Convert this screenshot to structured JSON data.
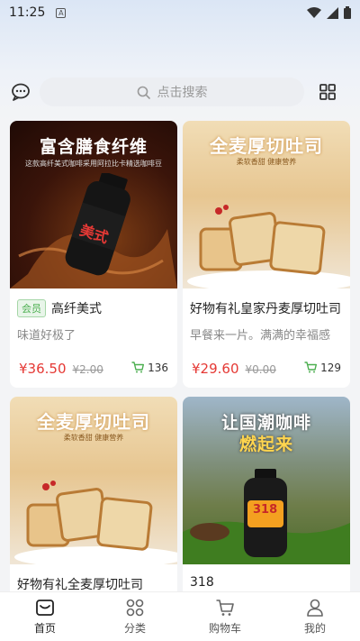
{
  "status_bar": {
    "time": "11:25",
    "notify_badge": "A"
  },
  "search": {
    "placeholder": "点击搜索"
  },
  "products": [
    {
      "name": "高纤美式",
      "badge": "会员",
      "desc": "味道好极了",
      "price": "¥36.50",
      "orig": "¥2.00",
      "cart_count": "136",
      "image_title": "富含膳食纤维",
      "image_sub": "这款高纤美式咖啡采用阿拉比卡精选咖啡豆",
      "image_label": "美式"
    },
    {
      "name": "好物有礼皇家丹麦厚切吐司",
      "badge": "",
      "desc": "早餐来一片。满满的幸福感",
      "price": "¥29.60",
      "orig": "¥0.00",
      "cart_count": "129",
      "image_title": "全麦厚切吐司",
      "image_sub": "柔软香甜  健康营养"
    },
    {
      "name": "好物有礼全麦厚切吐司",
      "badge": "",
      "desc": "",
      "price": "",
      "orig": "",
      "cart_count": "",
      "image_title": "全麦厚切吐司",
      "image_sub": "柔软香甜  健康营养"
    },
    {
      "name": "318",
      "badge": "",
      "desc": "",
      "price": "",
      "orig": "",
      "cart_count": "",
      "image_title": "让国潮咖啡",
      "image_title2": "燃起来",
      "image_label": "318"
    }
  ],
  "nav": [
    {
      "label": "首页",
      "icon": "home-icon"
    },
    {
      "label": "分类",
      "icon": "category-icon"
    },
    {
      "label": "购物车",
      "icon": "cart-icon"
    },
    {
      "label": "我的",
      "icon": "profile-icon"
    }
  ]
}
